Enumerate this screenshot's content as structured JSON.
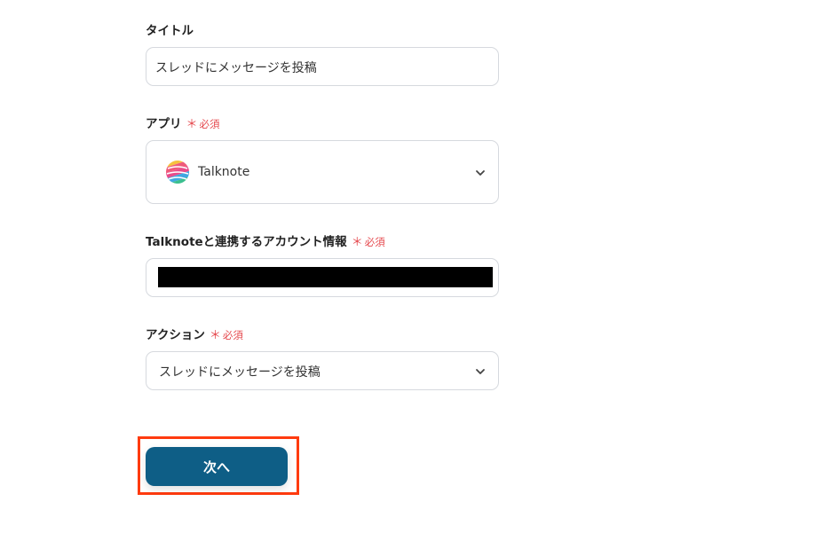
{
  "title_field": {
    "label": "タイトル",
    "value": "スレッドにメッセージを投稿"
  },
  "app_field": {
    "label": "アプリ",
    "required_mark": "＊",
    "required_text": "必須",
    "value": "Talknote",
    "logo_icon": "talknote-logo-icon"
  },
  "account_field": {
    "label": "Talknoteと連携するアカウント情報",
    "required_mark": "＊",
    "required_text": "必須"
  },
  "action_field": {
    "label": "アクション",
    "required_mark": "＊",
    "required_text": "必須",
    "value": "スレッドにメッセージを投稿"
  },
  "next_button": {
    "label": "次へ",
    "color": "#0e5e86",
    "highlight_color": "#ff3b0f"
  },
  "colors": {
    "required": "#e5484d",
    "border": "#d6d9de"
  }
}
